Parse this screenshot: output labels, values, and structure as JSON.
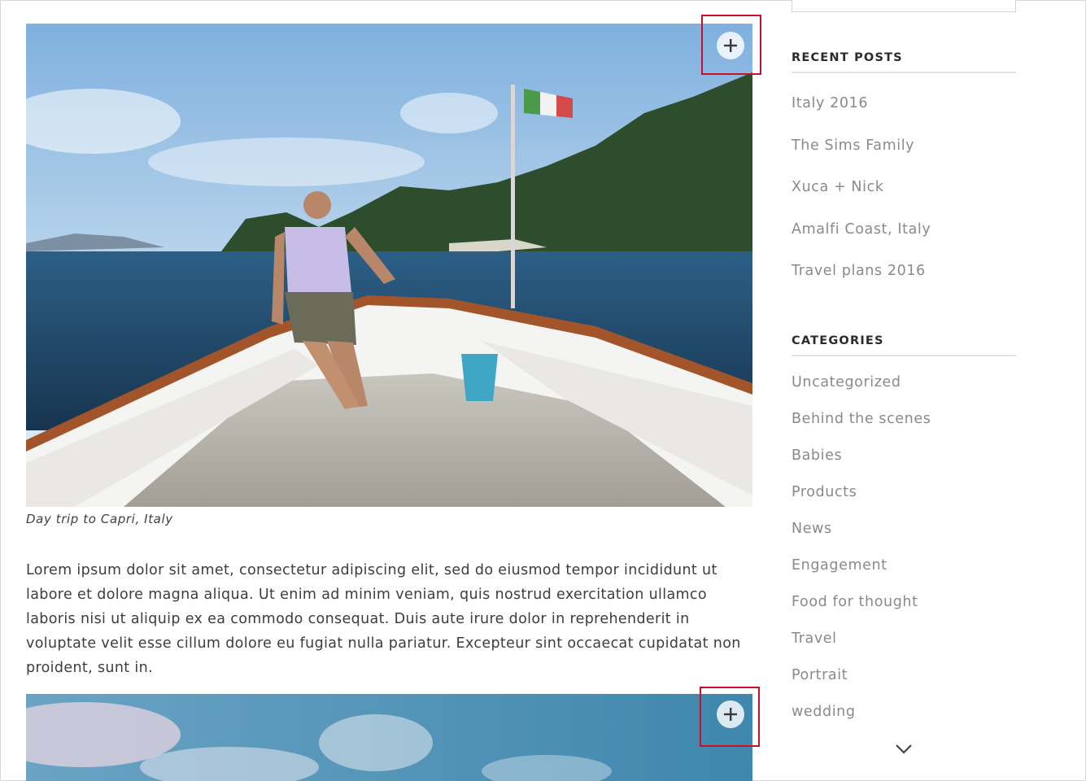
{
  "post": {
    "caption": "Day trip to Capri, Italy",
    "body": "Lorem ipsum dolor sit amet, consectetur adipiscing elit, sed do eiusmod tempor incididunt ut labore et dolore magna aliqua. Ut enim ad minim veniam, quis nostrud exercitation ullamco laboris nisi ut aliquip ex ea commodo consequat. Duis aute irure dolor in reprehenderit in voluptate velit esse cillum dolore eu fugiat nulla pariatur. Excepteur sint occaecat cupidatat non proident, sunt in.",
    "expand_icon": "plus-icon"
  },
  "sidebar": {
    "recent_posts": {
      "title": "RECENT POSTS",
      "items": [
        "Italy 2016",
        "The Sims Family",
        "Xuca + Nick",
        "Amalfi Coast, Italy",
        "Travel plans 2016"
      ]
    },
    "categories": {
      "title": "CATEGORIES",
      "items": [
        "Uncategorized",
        "Behind the scenes",
        "Babies",
        "Products",
        "News",
        "Engagement",
        "Food for thought",
        "Travel",
        "Portrait",
        "wedding"
      ]
    },
    "scroll_icon": "chevron-down-icon"
  },
  "colors": {
    "highlight": "#c8102e",
    "link": "#8a8a8a",
    "heading": "#2b2b2b",
    "divider": "#e3e3e3"
  }
}
